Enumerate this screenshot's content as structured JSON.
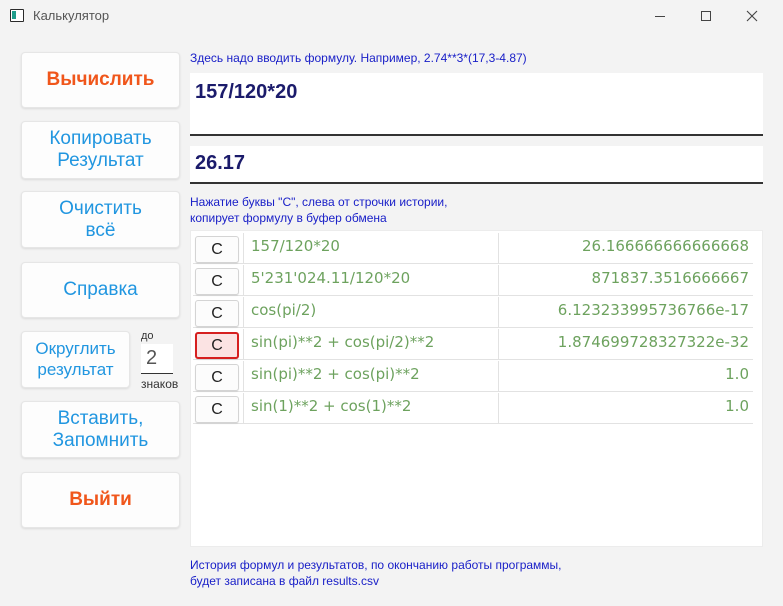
{
  "window": {
    "title": "Калькулятор"
  },
  "buttons": {
    "calculate": "Вычислить",
    "copy_result_line1": "Копировать",
    "copy_result_line2": "Результат",
    "clear_line1": "Очистить",
    "clear_line2": "всё",
    "help": "Справка",
    "round_line1": "Округлить",
    "round_line2": "результат",
    "insert_line1": "Вставить,",
    "insert_line2": "Запомнить",
    "exit": "Выйти"
  },
  "rounding": {
    "prefix": "до",
    "digits": "2",
    "suffix": "знаков"
  },
  "formula": {
    "hint": "Здесь надо вводить формулу. Например, 2.74**3*(17,3-4.87)",
    "value": "157/120*20"
  },
  "result": {
    "value": "26.17"
  },
  "history_hint": {
    "line1": "Нажатие буквы \"С\", слева от строчки истории,",
    "line2": "копирует формулу в буфер обмена"
  },
  "history": [
    {
      "button": "С",
      "formula": "157/120*20",
      "result": "26.166666666666668",
      "active": false
    },
    {
      "button": "С",
      "formula": "5'231'024.11/120*20",
      "result": "871837.3516666667",
      "active": false
    },
    {
      "button": "С",
      "formula": "cos(pi/2)",
      "result": "6.123233995736766e-17",
      "active": false
    },
    {
      "button": "С",
      "formula": "sin(pi)**2 + cos(pi/2)**2",
      "result": "1.874699728327322e-32",
      "active": true
    },
    {
      "button": "С",
      "formula": "sin(pi)**2 + cos(pi)**2",
      "result": "1.0",
      "active": false
    },
    {
      "button": "С",
      "formula": "sin(1)**2 + cos(1)**2",
      "result": "1.0",
      "active": false
    }
  ],
  "footer": {
    "line1": "История формул и результатов, по окончанию работы программы,",
    "line2": "будет записана в файл results.csv"
  },
  "colors": {
    "accent_orange": "#f0561b",
    "accent_blue": "#2196e0",
    "hint_blue": "#1a20c8",
    "history_green": "#6da25e",
    "active_border": "#d61f1f"
  }
}
